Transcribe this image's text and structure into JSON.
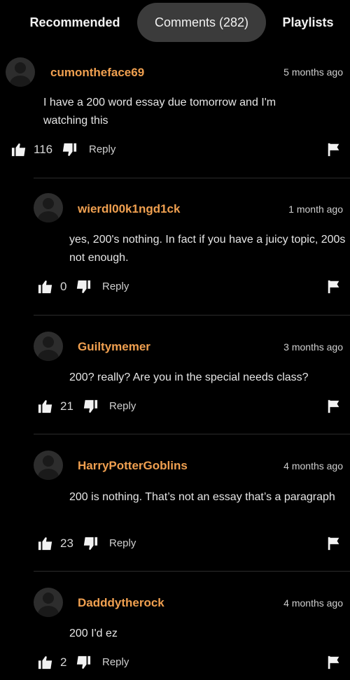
{
  "tabs": [
    {
      "label": "Recommended"
    },
    {
      "label": "Comments (282)"
    },
    {
      "label": "Playlists"
    }
  ],
  "comments": [
    {
      "username": "cumontheface69",
      "time": "5 months ago",
      "text": "I have a 200 word essay due tomorrow and I'm watching this",
      "likes": "116",
      "reply_label": "Reply"
    },
    {
      "username": "wierdl00k1ngd1ck",
      "time": "1 month ago",
      "text": "yes, 200's nothing. In fact if you have a juicy topic, 200s not enough.",
      "likes": "0",
      "reply_label": "Reply"
    },
    {
      "username": "Guiltymemer",
      "time": "3 months ago",
      "text": "200? really? Are you in the special needs class?",
      "likes": "21",
      "reply_label": "Reply"
    },
    {
      "username": "HarryPotterGoblins",
      "time": "4 months ago",
      "text": "200 is nothing. That’s not an essay that’s a paragraph",
      "likes": "23",
      "reply_label": "Reply"
    },
    {
      "username": "Dadddytherock",
      "time": "4 months ago",
      "text": "200 I'd ez",
      "likes": "2",
      "reply_label": "Reply"
    }
  ],
  "colors": {
    "background": "#000000",
    "username": "#f0a050",
    "active_tab": "#3b3b3b"
  },
  "icons": {
    "like": "thumbs-up-icon",
    "dislike": "thumbs-down-icon",
    "flag": "flag-icon",
    "avatar": "default-avatar-icon"
  }
}
